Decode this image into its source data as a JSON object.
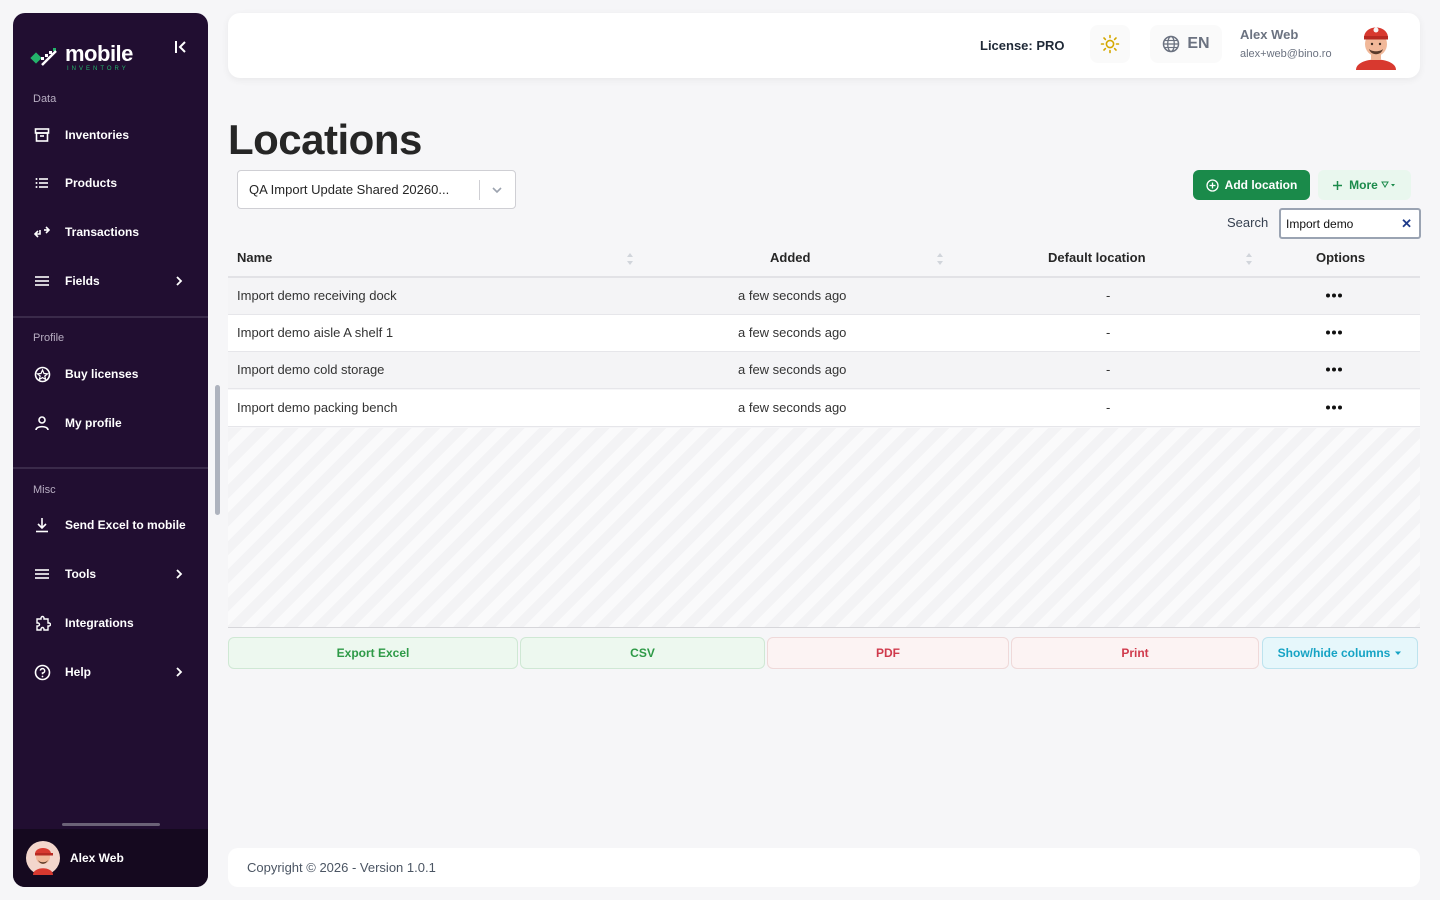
{
  "brand": {
    "name": "mobile",
    "sub": "INVENTORY"
  },
  "sidebar": {
    "sections": [
      {
        "label": "Data"
      },
      {
        "label": "Profile"
      },
      {
        "label": "Misc"
      }
    ],
    "items": [
      {
        "label": "Inventories",
        "icon": "archive-icon"
      },
      {
        "label": "Products",
        "icon": "list-icon"
      },
      {
        "label": "Transactions",
        "icon": "transfer-icon"
      },
      {
        "label": "Fields",
        "icon": "menu-icon"
      },
      {
        "label": "Buy licenses",
        "icon": "license-icon"
      },
      {
        "label": "My profile",
        "icon": "user-icon"
      },
      {
        "label": "Send Excel to mobile",
        "icon": "download-icon"
      },
      {
        "label": "Tools",
        "icon": "menu-icon"
      },
      {
        "label": "Integrations",
        "icon": "puzzle-icon"
      },
      {
        "label": "Help",
        "icon": "help-icon"
      }
    ],
    "user": {
      "name": "Alex Web"
    }
  },
  "header": {
    "license": "License: PRO",
    "language": "EN",
    "user_name": "Alex Web",
    "user_email": "alex+web@bino.ro"
  },
  "page": {
    "title": "Locations",
    "inventory_select": "QA Import Update Shared 20260...",
    "add_button": "Add location",
    "more_button": "More",
    "search_label": "Search",
    "search_value": "Import demo"
  },
  "table": {
    "columns": [
      "Name",
      "Added",
      "Default location",
      "Options"
    ],
    "rows": [
      {
        "name": "Import demo receiving dock",
        "added": "a few seconds ago",
        "default": "-"
      },
      {
        "name": "Import demo aisle A shelf 1",
        "added": "a few seconds ago",
        "default": "-"
      },
      {
        "name": "Import demo cold storage",
        "added": "a few seconds ago",
        "default": "-"
      },
      {
        "name": "Import demo packing bench",
        "added": "a few seconds ago",
        "default": "-"
      }
    ]
  },
  "export": {
    "excel": "Export Excel",
    "csv": "CSV",
    "pdf": "PDF",
    "print": "Print",
    "columns": "Show/hide columns"
  },
  "footer": {
    "copyright": "Copyright © 2026 - Version 1.0.1"
  },
  "colors": {
    "sidebar_bg": "#210e31",
    "primary_green": "#1a8a4a",
    "brand_green": "#24b36b",
    "danger_red": "#d03a4c",
    "info_teal": "#16a3c4"
  }
}
